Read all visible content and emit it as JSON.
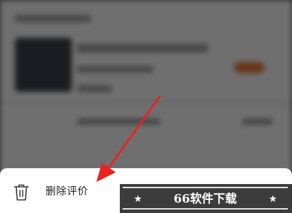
{
  "action_sheet": {
    "items": [
      {
        "label": "删除评价",
        "icon": "trash-icon"
      }
    ]
  },
  "annotation": {
    "arrow_color": "#e8231f"
  },
  "watermark": {
    "text": "66软件下载",
    "star_left": "★",
    "star_right": "★"
  },
  "colors": {
    "overlay": "rgba(0,0,0,0.55)",
    "sheet_background": "#ffffff",
    "watermark_background": "#3c3c3c"
  }
}
